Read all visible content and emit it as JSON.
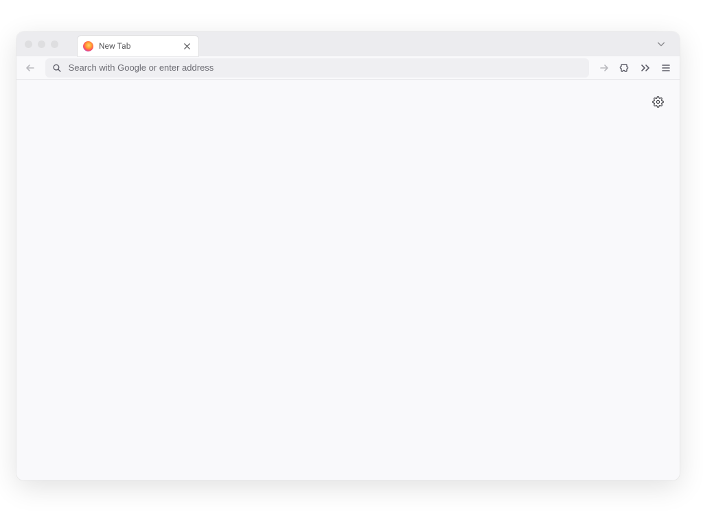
{
  "tab": {
    "title": "New Tab"
  },
  "urlbar": {
    "placeholder": "Search with Google or enter address"
  }
}
